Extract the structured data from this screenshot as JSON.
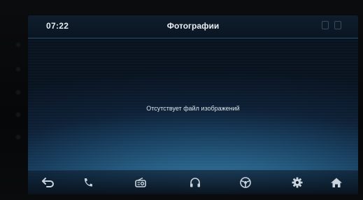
{
  "status_bar": {
    "time": "07:22",
    "title": "Фотографии"
  },
  "main": {
    "empty_message": "Отсутствует файл изображений"
  },
  "nav_bar": {
    "icons": [
      "back-icon",
      "phone-icon",
      "radio-icon",
      "headphones-icon",
      "steering-wheel-icon",
      "gear-icon",
      "home-icon"
    ]
  },
  "colors": {
    "text": "#e8eef4",
    "icon": "#c9d3dd",
    "background_glow": "#3d7ea6"
  }
}
